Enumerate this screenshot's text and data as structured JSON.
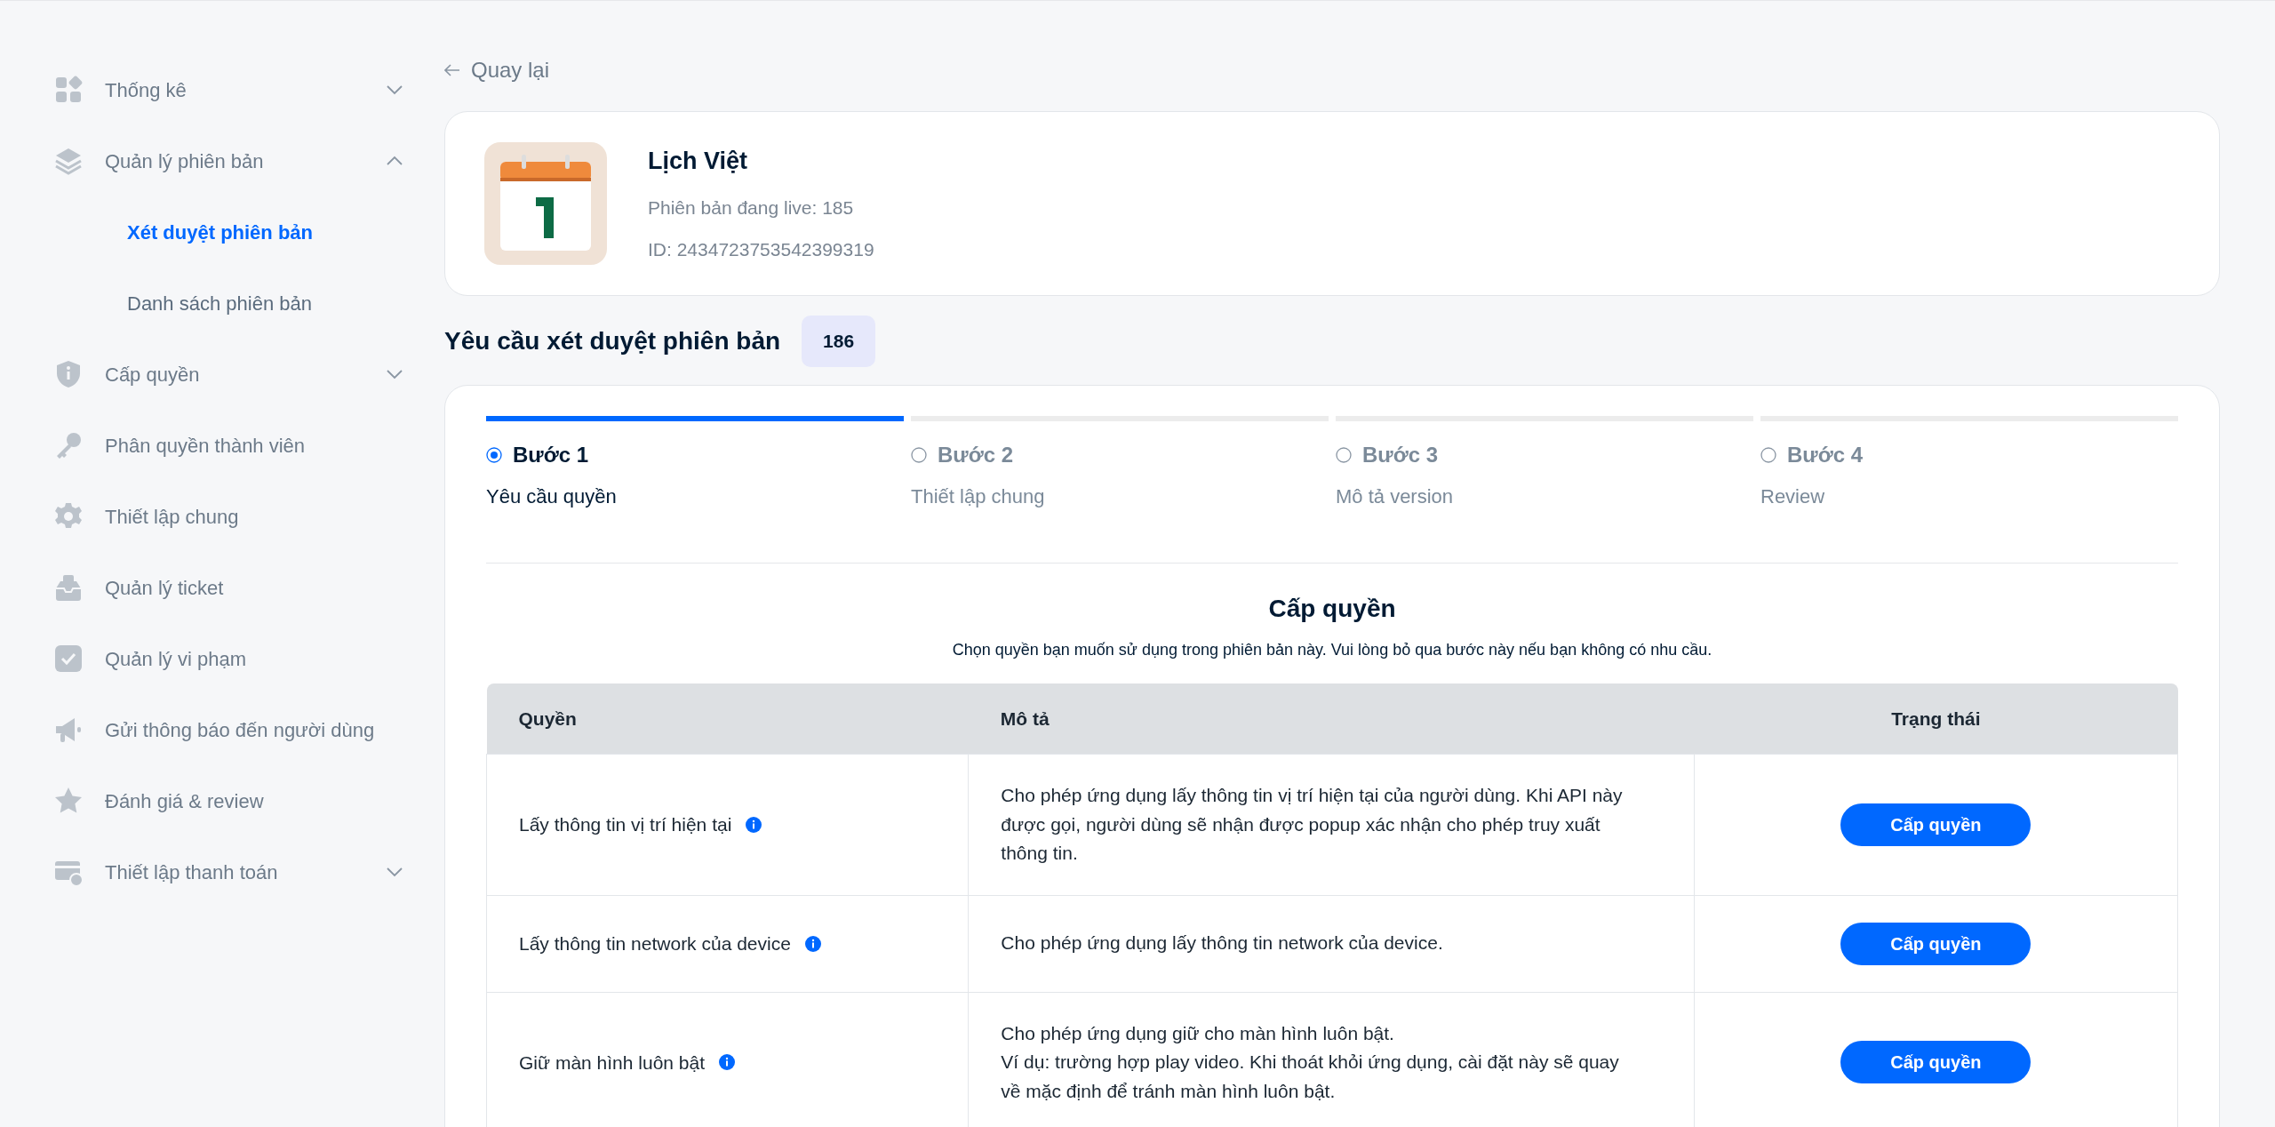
{
  "sidebar": {
    "items": [
      {
        "label": "Thống kê",
        "expanded": false
      },
      {
        "label": "Quản lý phiên bản",
        "expanded": true,
        "children": [
          {
            "label": "Xét duyệt phiên bản",
            "selected": true
          },
          {
            "label": "Danh sách phiên bản",
            "selected": false
          }
        ]
      },
      {
        "label": "Cấp quyền",
        "expanded": false
      },
      {
        "label": "Phân quyền thành viên"
      },
      {
        "label": "Thiết lập chung"
      },
      {
        "label": "Quản lý ticket"
      },
      {
        "label": "Quản lý vi phạm"
      },
      {
        "label": "Gửi thông báo đến người dùng"
      },
      {
        "label": "Đánh giá & review"
      },
      {
        "label": "Thiết lập thanh toán",
        "expanded": false
      }
    ]
  },
  "back_link": "Quay lại",
  "app": {
    "name": "Lịch Việt",
    "live_version": "Phiên bản đang live: 185",
    "id": "ID: 2434723753542399319"
  },
  "request": {
    "title": "Yêu cầu xét duyệt phiên bản",
    "version": "186"
  },
  "steps": [
    {
      "label": "Bước 1",
      "caption": "Yêu cầu quyền",
      "selected": true
    },
    {
      "label": "Bước 2",
      "caption": "Thiết lập chung",
      "selected": false
    },
    {
      "label": "Bước 3",
      "caption": "Mô tả version",
      "selected": false
    },
    {
      "label": "Bước 4",
      "caption": "Review",
      "selected": false
    }
  ],
  "section": {
    "title": "Cấp quyền",
    "subtitle": "Chọn quyền bạn muốn sử dụng trong phiên bản này. Vui lòng bỏ qua bước này nếu bạn không có nhu cầu."
  },
  "table": {
    "columns": [
      "Quyền",
      "Mô tả",
      "Trạng thái"
    ],
    "rows": [
      {
        "permission": "Lấy thông tin vị trí hiện tại",
        "description": "Cho phép ứng dụng lấy thông tin vị trí hiện tại của người dùng. Khi API này được gọi, người dùng sẽ nhận được popup xác nhận cho phép truy xuất thông tin.",
        "action": "Cấp quyền"
      },
      {
        "permission": "Lấy thông tin network của device",
        "description": "Cho phép ứng dụng lấy thông tin network của device.",
        "action": "Cấp quyền"
      },
      {
        "permission": "Giữ màn hình luôn bật",
        "description": "Cho phép ứng dụng giữ cho màn hình luôn bật.\nVí dụ: trường hợp play video. Khi thoát khỏi ứng dụng, cài đặt này sẽ quay về mặc định để tránh màn hình luôn bật.",
        "action": "Cấp quyền"
      }
    ]
  }
}
